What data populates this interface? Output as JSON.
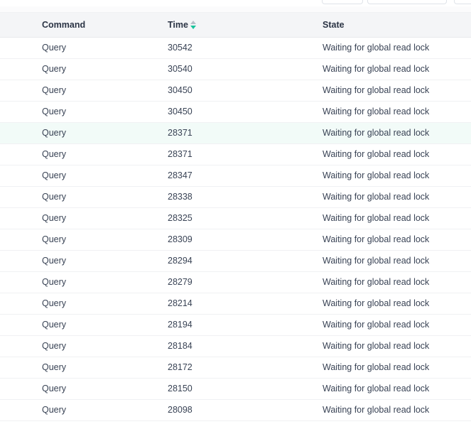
{
  "toolbar": {
    "controls": [
      {
        "name": "toolbar-control-left",
        "label": ""
      },
      {
        "name": "toolbar-search-input",
        "label": ""
      },
      {
        "name": "toolbar-control-right",
        "label": ""
      }
    ]
  },
  "table": {
    "columns": [
      {
        "key": "command",
        "label": "Command",
        "sortable": true,
        "sorted": false
      },
      {
        "key": "time",
        "label": "Time",
        "sortable": true,
        "sorted": true,
        "sort_direction": "desc"
      },
      {
        "key": "state",
        "label": "State",
        "sortable": true,
        "sorted": false
      }
    ],
    "sort_icon": {
      "ascending_name": "caret-up-icon",
      "descending_name": "caret-down-icon",
      "active_color": "#19c39c",
      "inactive_color": "#b9bfc8"
    },
    "highlight_color": "#f2fbf8",
    "highlighted_row_index": 4,
    "rows": [
      {
        "command": "Query",
        "time": "30542",
        "state": "Waiting for global read lock"
      },
      {
        "command": "Query",
        "time": "30540",
        "state": "Waiting for global read lock"
      },
      {
        "command": "Query",
        "time": "30450",
        "state": "Waiting for global read lock"
      },
      {
        "command": "Query",
        "time": "30450",
        "state": "Waiting for global read lock"
      },
      {
        "command": "Query",
        "time": "28371",
        "state": "Waiting for global read lock"
      },
      {
        "command": "Query",
        "time": "28371",
        "state": "Waiting for global read lock"
      },
      {
        "command": "Query",
        "time": "28347",
        "state": "Waiting for global read lock"
      },
      {
        "command": "Query",
        "time": "28338",
        "state": "Waiting for global read lock"
      },
      {
        "command": "Query",
        "time": "28325",
        "state": "Waiting for global read lock"
      },
      {
        "command": "Query",
        "time": "28309",
        "state": "Waiting for global read lock"
      },
      {
        "command": "Query",
        "time": "28294",
        "state": "Waiting for global read lock"
      },
      {
        "command": "Query",
        "time": "28279",
        "state": "Waiting for global read lock"
      },
      {
        "command": "Query",
        "time": "28214",
        "state": "Waiting for global read lock"
      },
      {
        "command": "Query",
        "time": "28194",
        "state": "Waiting for global read lock"
      },
      {
        "command": "Query",
        "time": "28184",
        "state": "Waiting for global read lock"
      },
      {
        "command": "Query",
        "time": "28172",
        "state": "Waiting for global read lock"
      },
      {
        "command": "Query",
        "time": "28150",
        "state": "Waiting for global read lock"
      },
      {
        "command": "Query",
        "time": "28098",
        "state": "Waiting for global read lock"
      }
    ]
  }
}
